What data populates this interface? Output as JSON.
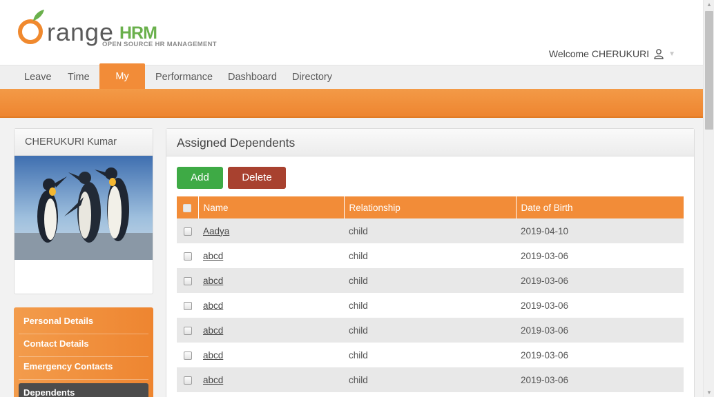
{
  "logo": {
    "word": "range",
    "hrm": "HRM",
    "tagline": "OPEN SOURCE HR MANAGEMENT"
  },
  "user": {
    "welcome": "Welcome CHERUKURI"
  },
  "nav": [
    {
      "label": "Leave"
    },
    {
      "label": "Time"
    },
    {
      "label": "My Info"
    },
    {
      "label": "Performance"
    },
    {
      "label": "Dashboard"
    },
    {
      "label": "Directory"
    }
  ],
  "profile": {
    "name": "CHERUKURI Kumar"
  },
  "side_menu": [
    {
      "label": "Personal Details"
    },
    {
      "label": "Contact Details"
    },
    {
      "label": "Emergency Contacts"
    },
    {
      "label": "Dependents"
    }
  ],
  "panel": {
    "title": "Assigned Dependents",
    "add_label": "Add",
    "delete_label": "Delete",
    "columns": [
      "Name",
      "Relationship",
      "Date of Birth"
    ],
    "rows": [
      {
        "name": "Aadya",
        "relationship": "child",
        "dob": "2019-04-10"
      },
      {
        "name": "abcd",
        "relationship": "child",
        "dob": "2019-03-06"
      },
      {
        "name": "abcd",
        "relationship": "child",
        "dob": "2019-03-06"
      },
      {
        "name": "abcd",
        "relationship": "child",
        "dob": "2019-03-06"
      },
      {
        "name": "abcd",
        "relationship": "child",
        "dob": "2019-03-06"
      },
      {
        "name": "abcd",
        "relationship": "child",
        "dob": "2019-03-06"
      },
      {
        "name": "abcd",
        "relationship": "child",
        "dob": "2019-03-06"
      }
    ]
  },
  "colors": {
    "accent": "#f28c38",
    "add": "#3eaa45",
    "delete": "#a8412f",
    "active_menu": "#4c4c4c"
  }
}
